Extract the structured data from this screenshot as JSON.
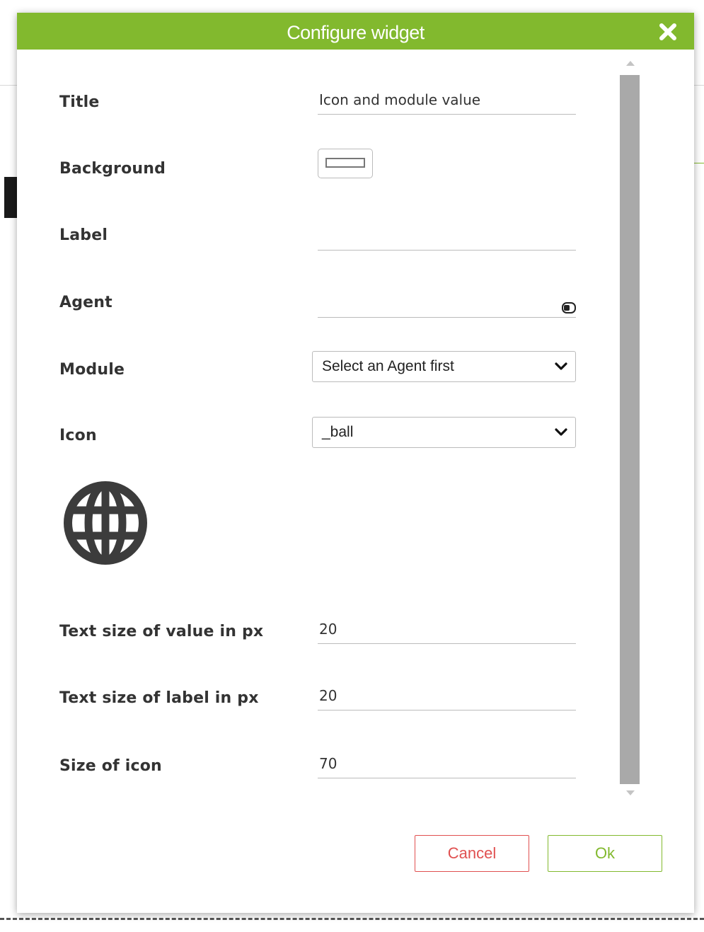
{
  "dialog": {
    "title": "Configure widget",
    "close_icon": "close-icon"
  },
  "form": {
    "title": {
      "label": "Title",
      "value": "Icon and module value"
    },
    "background": {
      "label": "Background",
      "color": "#ffffff"
    },
    "label": {
      "label": "Label",
      "value": ""
    },
    "agent": {
      "label": "Agent",
      "value": "",
      "icon": "agent-lookup-icon"
    },
    "module": {
      "label": "Module",
      "selected": "Select an Agent first"
    },
    "icon": {
      "label": "Icon",
      "selected": "_ball",
      "preview_icon": "globe-icon"
    },
    "text_size_value": {
      "label": "Text size of value in px",
      "value": "20"
    },
    "text_size_label": {
      "label": "Text size of label in px",
      "value": "20"
    },
    "icon_size": {
      "label": "Size of icon",
      "value": "70"
    }
  },
  "buttons": {
    "cancel": "Cancel",
    "ok": "Ok"
  },
  "colors": {
    "titlebar": "#82b92e",
    "ok": "#82b92e",
    "cancel": "#e05050"
  }
}
